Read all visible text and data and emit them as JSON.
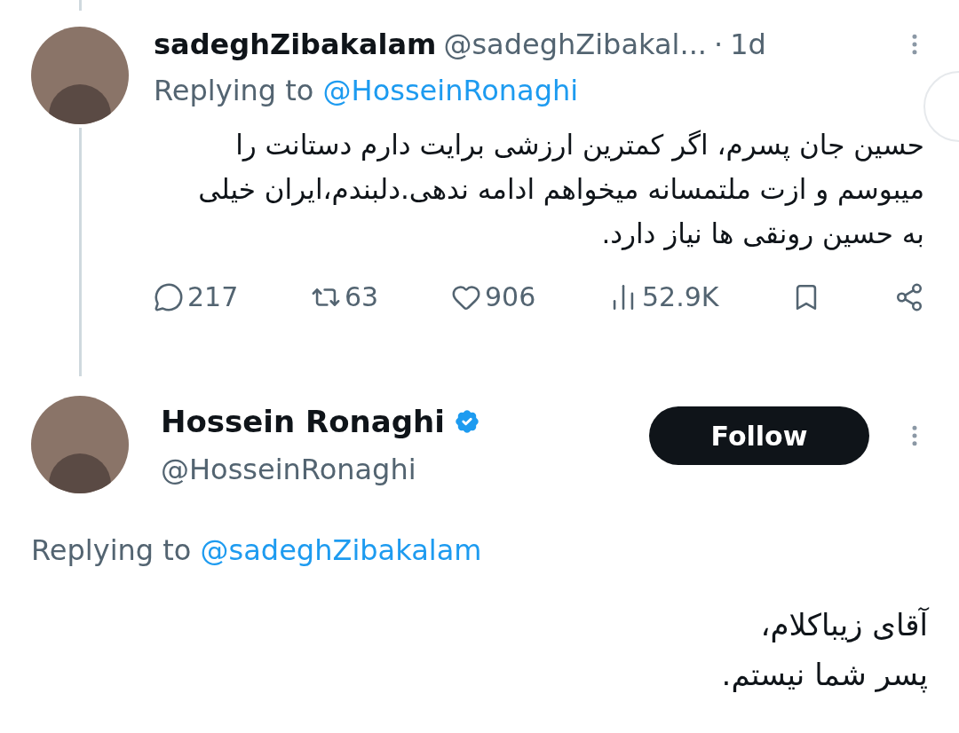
{
  "tweets": [
    {
      "name": "sadeghZibakalam",
      "handle": "@sadeghZibakal...",
      "separator": "·",
      "time": "1d",
      "replying_label": "Replying to",
      "replying_to": "@HosseinRonaghi",
      "text": "حسین جان پسرم، اگر کمترین ارزشی برایت دارم دستانت را میبوسم و ازت ملتمسانه میخواهم ادامه ندهی.دلبندم،ایران خیلی به حسین رونقی ها  نیاز دارد.",
      "replies": "217",
      "reposts": "63",
      "likes": "906",
      "views": "52.9K"
    },
    {
      "name": "Hossein Ronaghi",
      "verified": true,
      "handle": "@HosseinRonaghi",
      "follow_button": "Follow",
      "replying_label": "Replying to",
      "replying_to": "@sadeghZibakalam",
      "text": "آقای زیباکلام،\nپسر شما نیستم."
    }
  ]
}
